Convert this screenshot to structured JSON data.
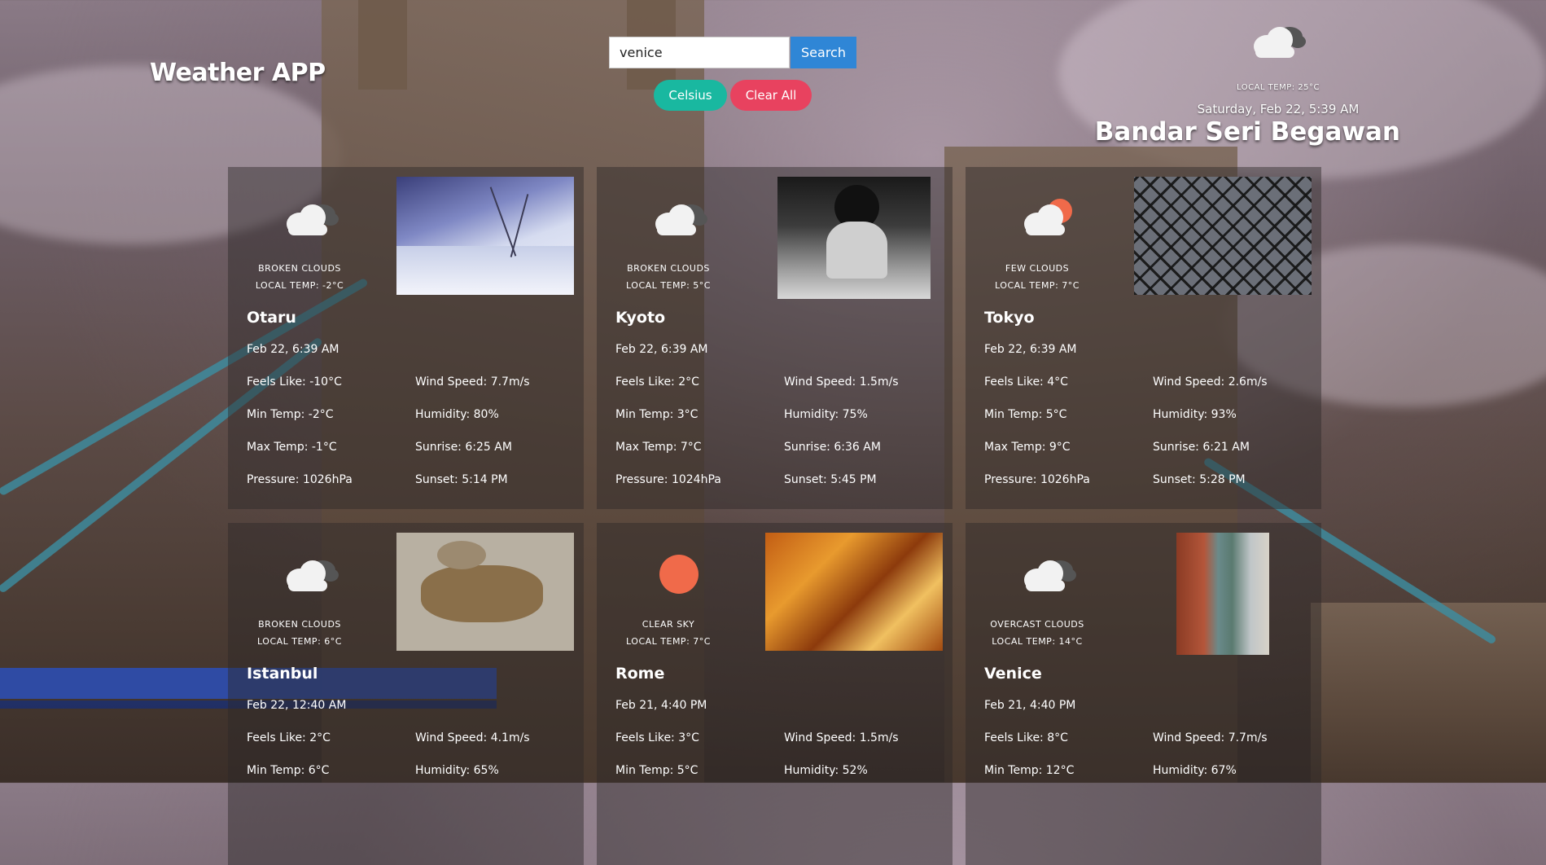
{
  "app": {
    "title": "Weather APP"
  },
  "search": {
    "value": "venice",
    "button_label": "Search"
  },
  "controls": {
    "unit_label": "Celsius",
    "clear_label": "Clear All"
  },
  "local": {
    "icon": "broken-clouds-icon",
    "temp_label": "LOCAL TEMP: 25°C",
    "datetime": "Saturday, Feb 22, 5:39 AM",
    "city": "Bandar Seri Begawan"
  },
  "cards": [
    {
      "city": "Otaru",
      "date": "Feb 22, 6:39 AM",
      "description": "BROKEN CLOUDS",
      "local_temp": "LOCAL TEMP: -2°C",
      "icon": "broken-clouds-icon",
      "photo": "snowy-landscape-photo",
      "feels_like": "Feels Like: -10°C",
      "min_temp": "Min Temp: -2°C",
      "max_temp": "Max Temp: -1°C",
      "pressure": "Pressure: 1026hPa",
      "wind": "Wind Speed: 7.7m/s",
      "humidity": "Humidity: 80%",
      "sunrise": "Sunrise: 6:25 AM",
      "sunset": "Sunset: 5:14 PM"
    },
    {
      "city": "Kyoto",
      "date": "Feb 22, 6:39 AM",
      "description": "BROKEN CLOUDS",
      "local_temp": "LOCAL TEMP: 5°C",
      "icon": "broken-clouds-icon",
      "photo": "geisha-photo",
      "feels_like": "Feels Like: 2°C",
      "min_temp": "Min Temp: 3°C",
      "max_temp": "Max Temp: 7°C",
      "pressure": "Pressure: 1024hPa",
      "wind": "Wind Speed: 1.5m/s",
      "humidity": "Humidity: 75%",
      "sunrise": "Sunrise: 6:36 AM",
      "sunset": "Sunset: 5:45 PM"
    },
    {
      "city": "Tokyo",
      "date": "Feb 22, 6:39 AM",
      "description": "FEW CLOUDS",
      "local_temp": "LOCAL TEMP: 7°C",
      "icon": "few-clouds-icon",
      "photo": "glass-roof-photo",
      "feels_like": "Feels Like: 4°C",
      "min_temp": "Min Temp: 5°C",
      "max_temp": "Max Temp: 9°C",
      "pressure": "Pressure: 1026hPa",
      "wind": "Wind Speed: 2.6m/s",
      "humidity": "Humidity: 93%",
      "sunrise": "Sunrise: 6:21 AM",
      "sunset": "Sunset: 5:28 PM"
    },
    {
      "city": "Istanbul",
      "date": "Feb 22, 12:40 AM",
      "description": "BROKEN CLOUDS",
      "local_temp": "LOCAL TEMP: 6°C",
      "icon": "broken-clouds-icon",
      "photo": "mosaic-griffin-photo",
      "feels_like": "Feels Like: 2°C",
      "min_temp": "Min Temp: 6°C",
      "wind": "Wind Speed: 4.1m/s",
      "humidity": "Humidity: 65%"
    },
    {
      "city": "Rome",
      "date": "Feb 21, 4:40 PM",
      "description": "CLEAR SKY",
      "local_temp": "LOCAL TEMP: 7°C",
      "icon": "clear-sky-sun-icon",
      "photo": "marble-texture-photo",
      "feels_like": "Feels Like: 3°C",
      "min_temp": "Min Temp: 5°C",
      "wind": "Wind Speed: 1.5m/s",
      "humidity": "Humidity: 52%"
    },
    {
      "city": "Venice",
      "date": "Feb 21, 4:40 PM",
      "description": "OVERCAST CLOUDS",
      "local_temp": "LOCAL TEMP: 14°C",
      "icon": "overcast-clouds-icon",
      "photo": "venice-canal-photo",
      "feels_like": "Feels Like: 8°C",
      "min_temp": "Min Temp: 12°C",
      "wind": "Wind Speed: 7.7m/s",
      "humidity": "Humidity: 67%"
    }
  ]
}
